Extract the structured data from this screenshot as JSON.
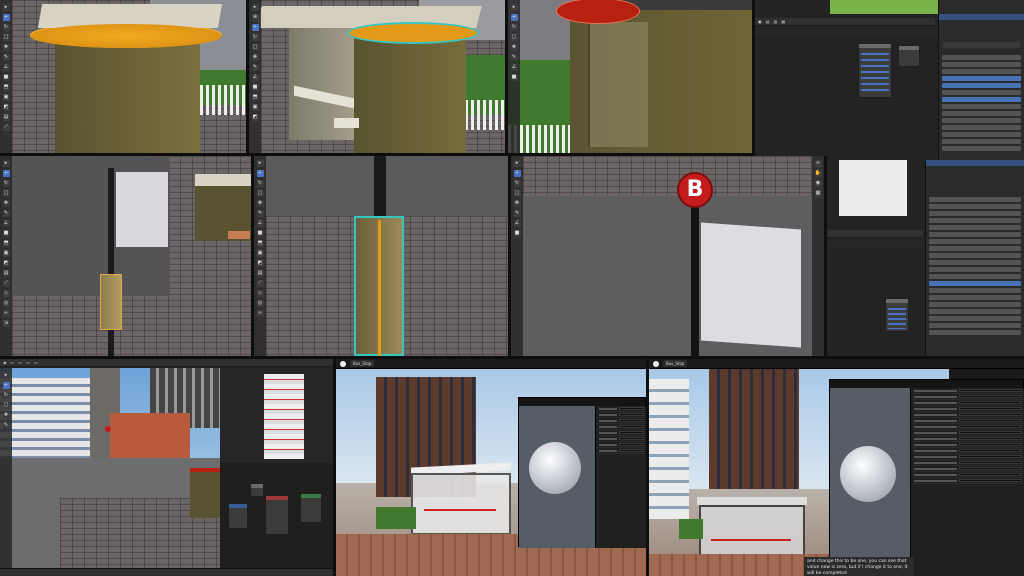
{
  "colors": {
    "accent_orange": "#e49a18",
    "select_teal": "#35c6c0",
    "red_top": "#b8210f",
    "stop_sign_red": "#c41c1c",
    "blender_dark": "#2a2a2a",
    "blender_select": "#4772b3",
    "ue_dark": "#1a1a1a",
    "shelter_olive": "#6e6432"
  },
  "stop_sign": {
    "letter": "B"
  },
  "ue_toolbar": {
    "tab_left": "Bus_Stop",
    "tab_right": "Bus_Stop"
  },
  "subtitle": {
    "text": "and change this to be one, you can see that value now is zero, but if I change it to one, it will be completed"
  },
  "icons": [
    "move-tool-icon",
    "rotate-tool-icon",
    "scale-tool-icon",
    "transform-tool-icon",
    "annotate-tool-icon",
    "measure-tool-icon",
    "add-cube-tool-icon"
  ]
}
